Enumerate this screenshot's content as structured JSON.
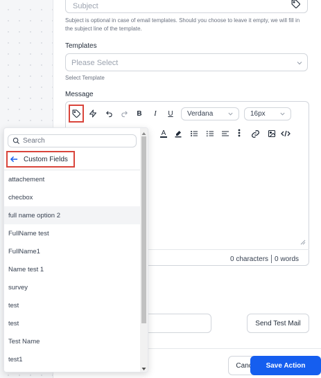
{
  "form": {
    "subject_placeholder": "Subject",
    "subject_help": "Subject is optional in case of email templates. Should you choose to leave it empty, we will fill in the subject line of the template.",
    "templates_label": "Templates",
    "templates_placeholder": "Please Select",
    "templates_help": "Select Template",
    "message_label": "Message"
  },
  "toolbar": {
    "font_family": "Verdana",
    "font_size": "16px"
  },
  "editor": {
    "char_count": "0 characters",
    "word_count": "0 words"
  },
  "dropdown": {
    "search_placeholder": "Search",
    "back_label": "Custom Fields",
    "items": [
      "attachement",
      "checbox",
      "full name option 2",
      "FullName test",
      "FullName1",
      "Name test 1",
      "survey",
      "test",
      "test",
      "Test Name",
      "test1"
    ],
    "highlighted_index": 2
  },
  "actions": {
    "send_test_mail": "Send Test Mail",
    "cancel": "Cancel",
    "save": "Save Action"
  },
  "colors": {
    "primary": "#155eef",
    "highlight_border": "#d9443a"
  }
}
